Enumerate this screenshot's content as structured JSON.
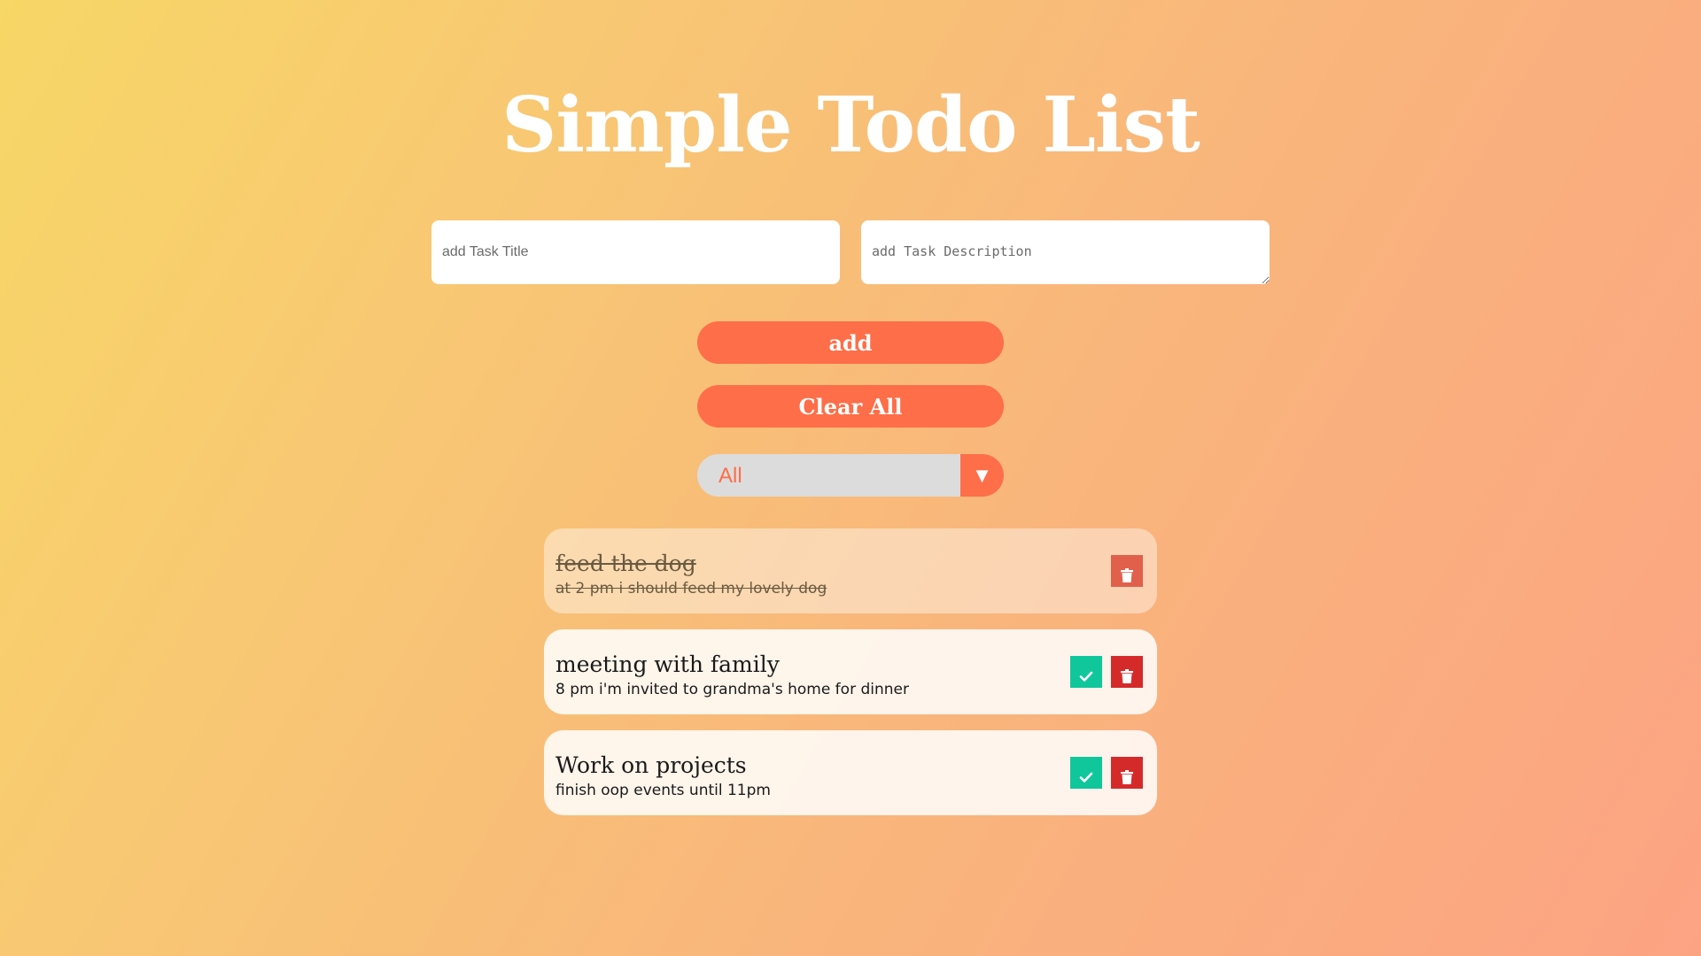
{
  "page": {
    "title": "Simple Todo List"
  },
  "form": {
    "title_placeholder": "add Task Title",
    "title_value": "",
    "description_placeholder": "add Task Description",
    "description_value": "",
    "add_label": "add",
    "clear_label": "Clear All"
  },
  "filter": {
    "selected": "All",
    "arrow_icon": "triangle-down"
  },
  "todos": [
    {
      "title": "feed the dog",
      "description": "at 2 pm i should feed my lovely dog",
      "completed": true
    },
    {
      "title": "meeting with family",
      "description": "8 pm i'm invited to grandma's home for dinner",
      "completed": false
    },
    {
      "title": "Work on projects",
      "description": "finish oop events until 11pm",
      "completed": false
    }
  ],
  "icons": {
    "complete": "check-icon",
    "delete": "trash-icon"
  },
  "colors": {
    "accent": "#fe6e48",
    "complete_button": "#10c79c",
    "delete_button": "#d52a2a",
    "background_start": "#f7d766",
    "background_end": "#fca383"
  }
}
